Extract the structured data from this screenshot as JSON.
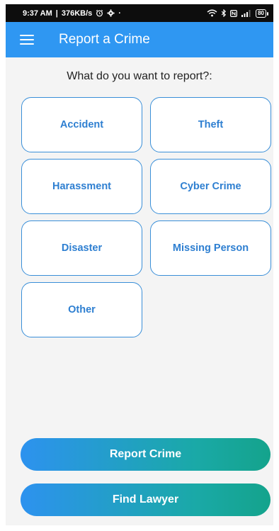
{
  "status_bar": {
    "time": "9:37 AM",
    "speed": "376KB/s",
    "dot": "·",
    "battery": "80"
  },
  "app_bar": {
    "title": "Report a Crime"
  },
  "main": {
    "question": "What do you want to report?:",
    "categories": [
      {
        "label": "Accident"
      },
      {
        "label": "Theft"
      },
      {
        "label": "Harassment"
      },
      {
        "label": "Cyber Crime"
      },
      {
        "label": "Disaster"
      },
      {
        "label": "Missing Person"
      },
      {
        "label": "Other"
      }
    ]
  },
  "actions": {
    "report_label": "Report Crime",
    "lawyer_label": "Find Lawyer"
  },
  "colors": {
    "app_bar": "#2f97f2",
    "category_text": "#2e7fd1",
    "gradient_start": "#2d92ef",
    "gradient_end": "#14a38c"
  }
}
